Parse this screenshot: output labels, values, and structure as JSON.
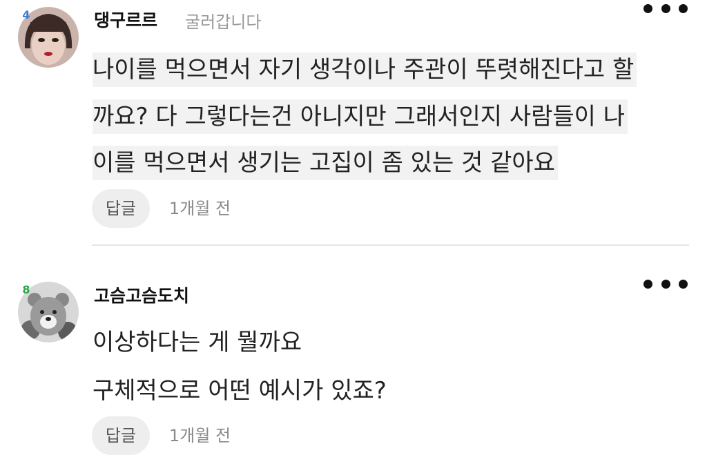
{
  "comments": [
    {
      "level_badge": "4",
      "username": "댕구르르",
      "status": "굴러갑니다",
      "lines": [
        "나이를 먹으면서 자기 생각이나 주관이 뚜렷해진다고 할",
        "까요? 다 그렇다는건 아니지만 그래서인지 사람들이 나",
        "이를 먹으면서 생기는 고집이 좀 있는 것 같아요"
      ],
      "reply_label": "답글",
      "timestamp": "1개월 전"
    },
    {
      "level_badge": "8",
      "username": "고슴고슴도치",
      "lines": [
        "이상하다는 게 뭘까요",
        "구체적으로 어떤 예시가 있죠?"
      ],
      "reply_label": "답글",
      "timestamp": "1개월 전"
    }
  ],
  "icons": {
    "more": "more-dots-icon",
    "level_badge_1_color": "#3a7bd5",
    "level_badge_2_color": "#2aa84a"
  }
}
